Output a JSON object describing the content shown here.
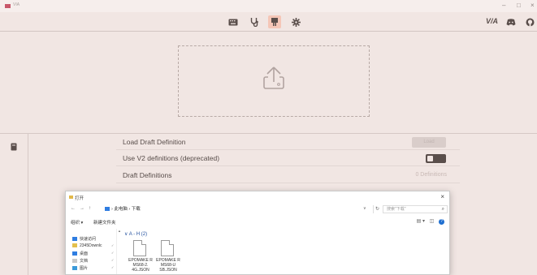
{
  "window": {
    "title": "VIA",
    "controls": {
      "minimize": "–",
      "maximize": "□",
      "close": "×"
    }
  },
  "toolbar": {
    "tools": [
      {
        "name": "keyboard-icon",
        "active": false
      },
      {
        "name": "stethoscope-icon",
        "active": false
      },
      {
        "name": "layout-design-icon",
        "active": true
      },
      {
        "name": "gear-icon",
        "active": false
      }
    ],
    "right_brand": "V/A"
  },
  "upload": {
    "icon": "upload-icon"
  },
  "sidebar": {
    "icon": "book-icon"
  },
  "settings": {
    "rows": [
      {
        "label": "Load Draft Definition",
        "control": "button",
        "button_label": "Load"
      },
      {
        "label": "Use V2 definitions (deprecated)",
        "control": "toggle",
        "toggle_on": true
      },
      {
        "label": "Draft Definitions",
        "control": "value",
        "value": "0 Definitions"
      }
    ]
  },
  "dialog": {
    "title": "打开",
    "close": "×",
    "nav": {
      "back": "←",
      "forward": "→",
      "up": "↑"
    },
    "address": "› 此电脑 › 下载",
    "refresh": "↻",
    "search_placeholder": "搜索\"下载\"",
    "commands": {
      "organize": "组织 ▾",
      "new_folder": "新建文件夹"
    },
    "help": "?",
    "nav_items": [
      {
        "label": "快速访问",
        "color": "#2f7de1"
      },
      {
        "label": "2345Downlc",
        "color": "#e3c04d"
      },
      {
        "label": "桌面",
        "color": "#2f7de1"
      },
      {
        "label": "文档",
        "color": "#c8c8c8"
      },
      {
        "label": "图片",
        "color": "#3b9ad9"
      }
    ],
    "group_label": "∨  A - H (2)",
    "files": [
      {
        "name": "EPOMAKE R MS68-2. 4G.JSON"
      },
      {
        "name": "EPOMAKE R MS68-U SB.JSON"
      }
    ]
  }
}
